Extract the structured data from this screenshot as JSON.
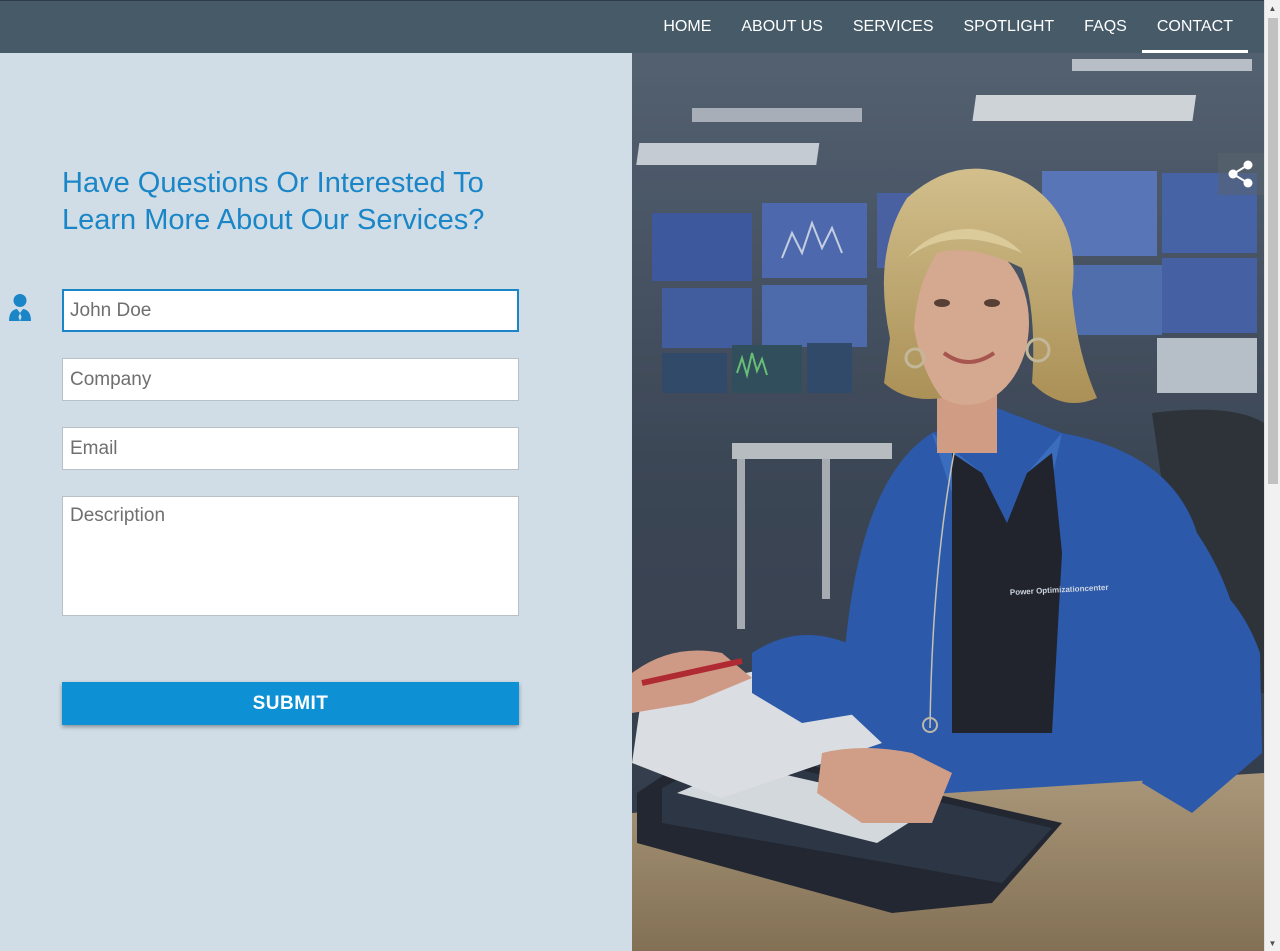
{
  "nav": {
    "items": [
      {
        "label": "HOME"
      },
      {
        "label": "ABOUT US"
      },
      {
        "label": "SERVICES"
      },
      {
        "label": "SPOTLIGHT"
      },
      {
        "label": "FAQS"
      },
      {
        "label": "CONTACT"
      }
    ],
    "active": "CONTACT"
  },
  "form": {
    "heading": "Have Questions Or Interested To Learn More About Our Services?",
    "name_placeholder": "John Doe",
    "company_placeholder": "Company",
    "email_placeholder": "Email",
    "description_placeholder": "Description",
    "submit_label": "SUBMIT"
  },
  "photo": {
    "shirt_text": "Power Optimizationcenter"
  },
  "colors": {
    "nav_bg": "#465a68",
    "accent": "#1a86c8",
    "button": "#0d91d4",
    "panel_bg": "#d0dde6"
  }
}
